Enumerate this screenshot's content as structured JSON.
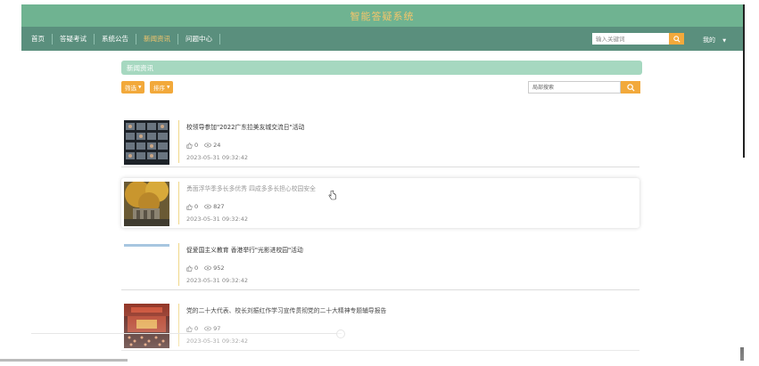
{
  "app": {
    "title": "智能答疑系统"
  },
  "nav": {
    "items": [
      {
        "label": "首页"
      },
      {
        "label": "答疑考试"
      },
      {
        "label": "系统公告"
      },
      {
        "label": "新闻资讯"
      },
      {
        "label": "问题中心"
      }
    ],
    "active_index": 3,
    "search": {
      "placeholder": "输入关键词",
      "value": ""
    },
    "mine_label": "我的"
  },
  "section": {
    "title": "新闻资讯"
  },
  "toolbar": {
    "filter_label": "筛选",
    "sort_label": "排序",
    "local_search": {
      "placeholder": "局部搜索",
      "value": ""
    }
  },
  "news": [
    {
      "title": "校领导参加\"2022广东拉美友城交流日\"活动",
      "likes": "0",
      "views": "24",
      "date": "2023-05-31 09:32:42"
    },
    {
      "title": "勇面浮华季多长多优秀 四成多多长担心校园安全",
      "likes": "0",
      "views": "827",
      "date": "2023-05-31 09:32:42"
    },
    {
      "title": "促爱国主义教育 香港举行\"光影进校园\"活动",
      "likes": "0",
      "views": "952",
      "date": "2023-05-31 09:32:42"
    },
    {
      "title": "党的二十大代表、校长刘振红作学习宣传贯彻党的二十大精神专题辅导报告",
      "likes": "0",
      "views": "97",
      "date": "2023-05-31 09:32:42"
    }
  ],
  "icons": {
    "search": "search-icon",
    "like": "thumbs-up-icon",
    "view": "eye-icon",
    "caret": "caret-down-icon"
  },
  "colors": {
    "header_bg": "#6fb391",
    "nav_bg": "#5a8f7d",
    "accent": "#f2a93b",
    "title_text": "#f4c56b",
    "section_bg": "#a6d8c0"
  }
}
